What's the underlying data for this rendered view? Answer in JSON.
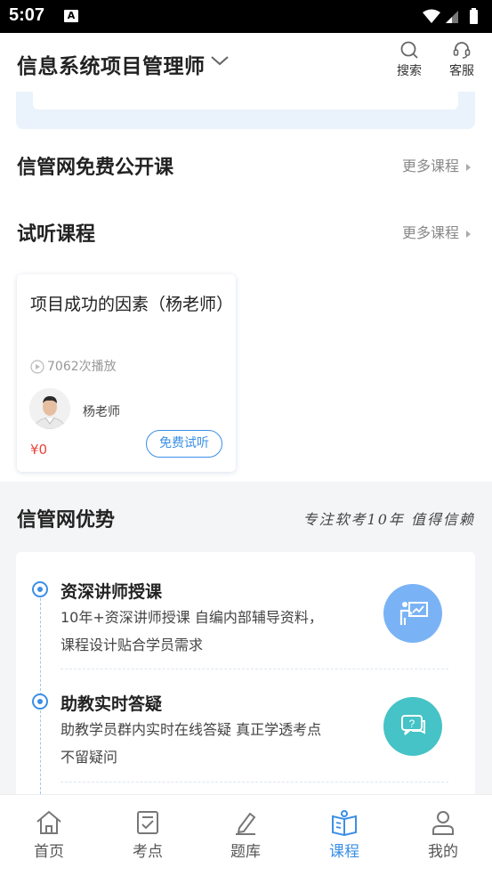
{
  "status_bar": {
    "time": "5:07",
    "notification_glyph": "A"
  },
  "header": {
    "title": "信息系统项目管理师",
    "search_label": "搜索",
    "service_label": "客服"
  },
  "free_courses": {
    "title": "信管网免费公开课",
    "more": "更多课程"
  },
  "trial_courses": {
    "title": "试听课程",
    "more": "更多课程",
    "items": [
      {
        "title": "项目成功的因素（杨老师）",
        "plays": "7062次播放",
        "teacher": "杨老师",
        "price": "¥0",
        "button": "免费试听"
      }
    ]
  },
  "advantages": {
    "title": "信管网优势",
    "slogan": "专注软考10年 值得信赖",
    "items": [
      {
        "title": "资深讲师授课",
        "desc": "10年+资深讲师授课 自编内部辅导资料，课程设计贴合学员需求",
        "icon": "teacher-board-icon",
        "color": "#7ab3f5"
      },
      {
        "title": "助教实时答疑",
        "desc": "助教学员群内实时在线答疑 真正学透考点不留疑问",
        "icon": "chat-question-icon",
        "color": "#45c3c6"
      }
    ]
  },
  "bottom_nav": {
    "items": [
      {
        "label": "首页",
        "icon": "home-icon",
        "active": false
      },
      {
        "label": "考点",
        "icon": "checklist-icon",
        "active": false
      },
      {
        "label": "题库",
        "icon": "edit-icon",
        "active": false
      },
      {
        "label": "课程",
        "icon": "book-icon",
        "active": true
      },
      {
        "label": "我的",
        "icon": "user-icon",
        "active": false
      }
    ]
  },
  "colors": {
    "accent": "#3b8fe5",
    "price": "#e8453c"
  }
}
